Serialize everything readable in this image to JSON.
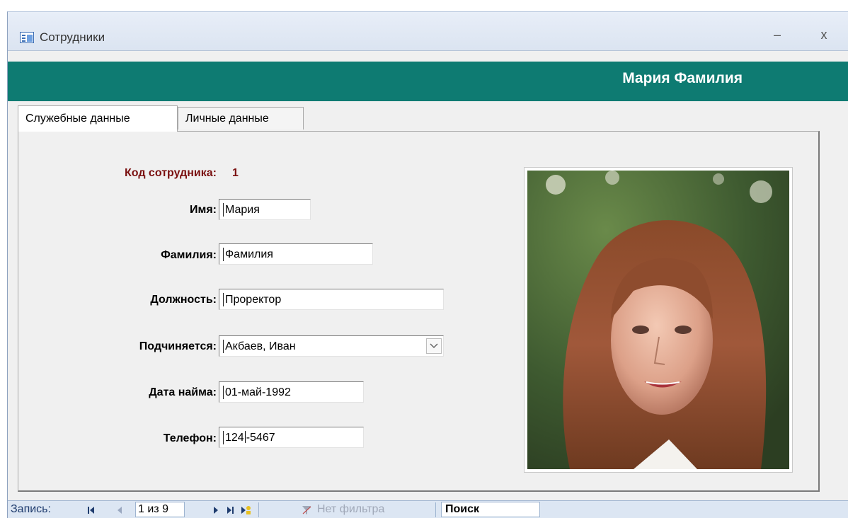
{
  "window": {
    "title": "Сотрудники",
    "minimize_label": "–",
    "close_label": "x"
  },
  "header": {
    "title": "Мария Фамилия"
  },
  "tabs": [
    {
      "label": "Служебные данные",
      "active": true
    },
    {
      "label": "Личные данные",
      "active": false
    }
  ],
  "form": {
    "employee_id_label": "Код сотрудника:",
    "employee_id_value": "1",
    "first_name_label": "Имя:",
    "first_name_value": "Мария",
    "last_name_label": "Фамилия:",
    "last_name_value": "Фамилия",
    "position_label": "Должность:",
    "position_value": "Проректор",
    "reports_to_label": "Подчиняется:",
    "reports_to_value": "Акбаев, Иван",
    "hire_date_label": "Дата найма:",
    "hire_date_value": "01-май-1992",
    "phone_label": "Телефон:",
    "phone_value_before_cursor": "124",
    "phone_value_after_cursor": "-5467"
  },
  "navigation": {
    "record_label": "Запись:",
    "position_text": "1 из 9",
    "filter_label": "Нет фильтра",
    "search_label": "Поиск"
  },
  "colors": {
    "header_bg": "#0e7b72",
    "id_label_color": "#7a1010",
    "navbar_bg": "#dce6f3"
  },
  "icons": [
    "form-icon",
    "first-record-icon",
    "prev-record-icon",
    "next-record-icon",
    "last-record-icon",
    "new-record-icon",
    "filter-icon",
    "dropdown-arrow-icon"
  ]
}
